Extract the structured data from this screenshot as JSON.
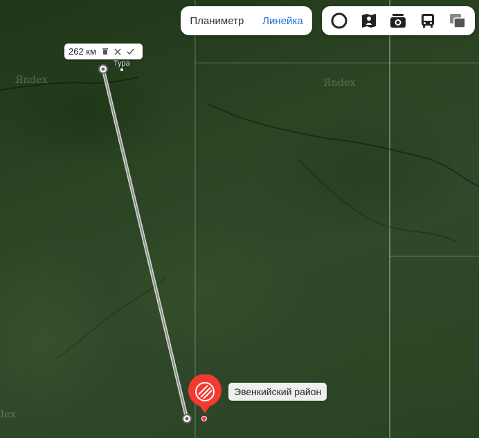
{
  "map": {
    "watermarks": [
      "Яndex",
      "Яndex",
      "Яndex"
    ]
  },
  "modes": {
    "planimeter": "Планиметр",
    "ruler": "Линейка",
    "active": "ruler"
  },
  "tools": [
    {
      "icon": "layers-circle-icon"
    },
    {
      "icon": "panorama-icon"
    },
    {
      "icon": "camera-icon"
    },
    {
      "icon": "bus-icon"
    },
    {
      "icon": "map-layers-icon"
    }
  ],
  "ruler": {
    "distance": "262 км"
  },
  "city": {
    "name": "Тура"
  },
  "place": {
    "name": "Эвенкийский район"
  },
  "colors": {
    "accent": "#1e6fd9",
    "pin": "#f4392f"
  }
}
